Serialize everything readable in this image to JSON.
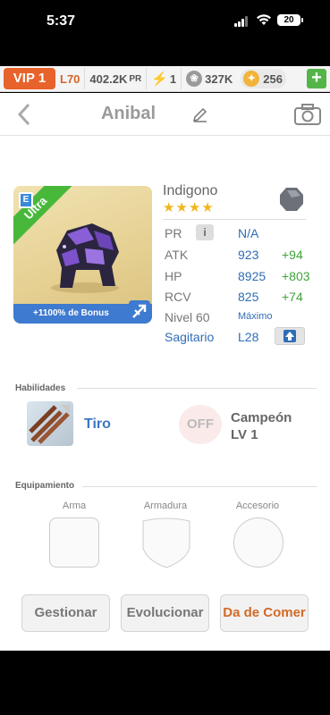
{
  "status": {
    "time": "5:37",
    "battery": "20"
  },
  "topbar": {
    "vip": "VIP 1",
    "level": "L70",
    "power": "402.2K",
    "power_suffix": "PR",
    "energy": "1",
    "paw_amount": "327K",
    "coins": "256",
    "plus": "+"
  },
  "header": {
    "title": "Anibal"
  },
  "monster": {
    "rarity": "Ultra",
    "bonus": "+1100% de Bonus",
    "name": "Indigono",
    "stars": "★★★★",
    "stats": {
      "pr_label": "PR",
      "pr_value": "N/A",
      "info": "i",
      "atk_label": "ATK",
      "atk_value": "923",
      "atk_bonus": "+94",
      "hp_label": "HP",
      "hp_value": "8925",
      "hp_bonus": "+803",
      "rcv_label": "RCV",
      "rcv_value": "825",
      "rcv_bonus": "+74",
      "level_label": "Nivel 60",
      "level_value": "Máximo",
      "sign": "Sagitario",
      "sign_level": "L28"
    }
  },
  "abilities": {
    "title": "Habilidades",
    "skill1": "Tiro",
    "skill2_badge": "OFF",
    "skill2_name": "Campeón",
    "skill2_level": "LV 1"
  },
  "equipment": {
    "title": "Equipamiento",
    "slots": [
      "Arma",
      "Armadura",
      "Accesorio"
    ]
  },
  "actions": {
    "manage": "Gestionar",
    "evolve": "Evolucionar",
    "feed": "Da de Comer"
  },
  "colors": {
    "vip_orange": "#e8632b",
    "accent_blue": "#2f6db7",
    "bonus_green": "#3fa33a",
    "feed_orange": "#d26a28"
  }
}
